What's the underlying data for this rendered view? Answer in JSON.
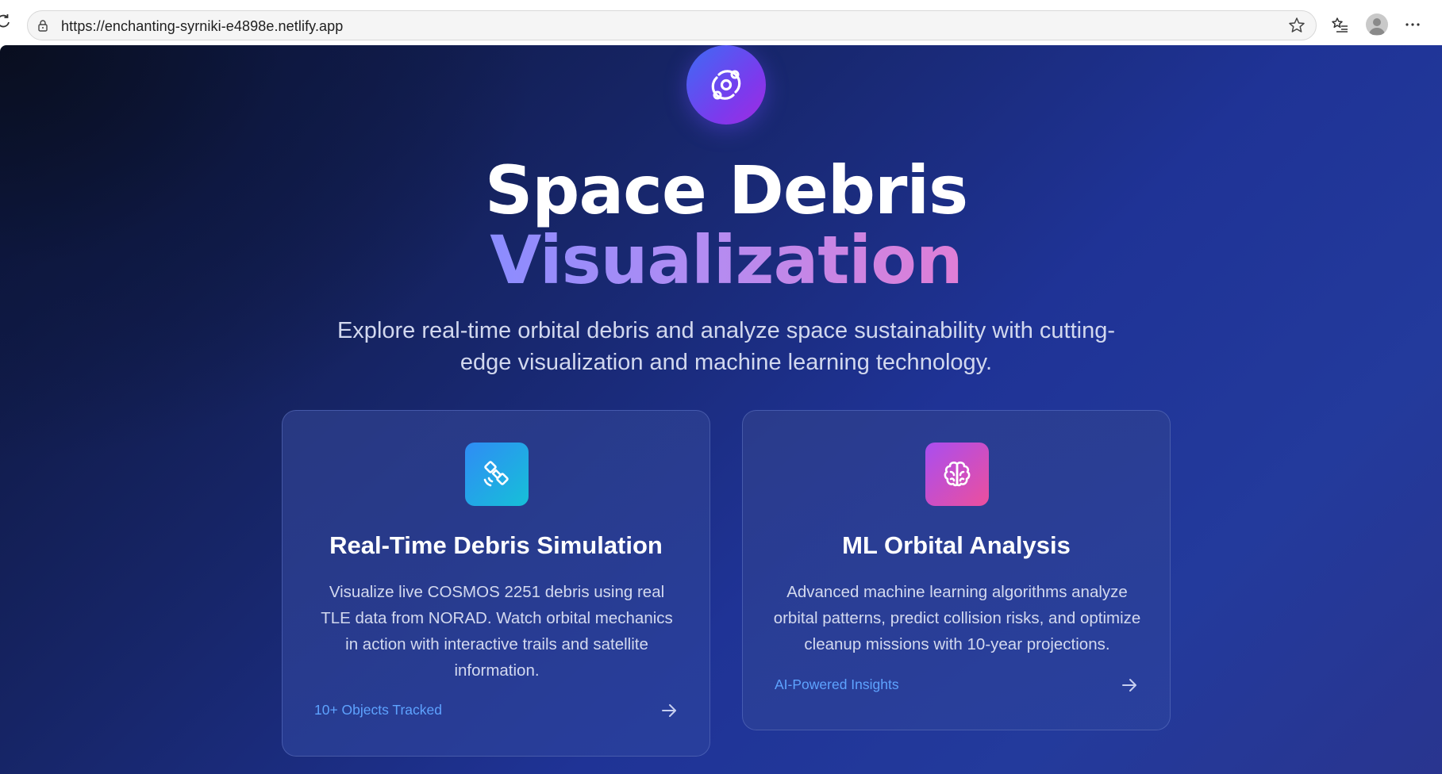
{
  "browser": {
    "url": "https://enchanting-syrniki-e4898e.netlify.app",
    "icons": [
      "reload-icon",
      "lock-icon",
      "favorite-star-icon",
      "favorites-list-icon",
      "profile-icon",
      "more-menu-icon"
    ]
  },
  "hero": {
    "logo_icon": "orbit-icon",
    "title_line1": "Space Debris",
    "title_line2": "Visualization",
    "subtitle": "Explore real-time orbital debris and analyze space sustainability with cutting-edge visualization and machine learning technology."
  },
  "cards": [
    {
      "icon": "satellite-icon",
      "icon_gradient": [
        "#2f8cf5",
        "#16c0d8"
      ],
      "title": "Real-Time Debris Simulation",
      "description": "Visualize live COSMOS 2251 debris using real TLE data from NORAD. Watch orbital mechanics in action with interactive trails and satellite information.",
      "tag": "10+ Objects Tracked"
    },
    {
      "icon": "brain-icon",
      "icon_gradient": [
        "#a94ef0",
        "#ec4f9d"
      ],
      "title": "ML Orbital Analysis",
      "description": "Advanced machine learning algorithms analyze orbital patterns, predict collision risks, and optimize cleanup missions with 10-year projections.",
      "tag": "AI-Powered Insights"
    }
  ],
  "colors": {
    "accent_blue": "#5ea3ff",
    "title_gradient": [
      "#8b8cff",
      "#e07ed6"
    ],
    "background": "#1f3396"
  }
}
